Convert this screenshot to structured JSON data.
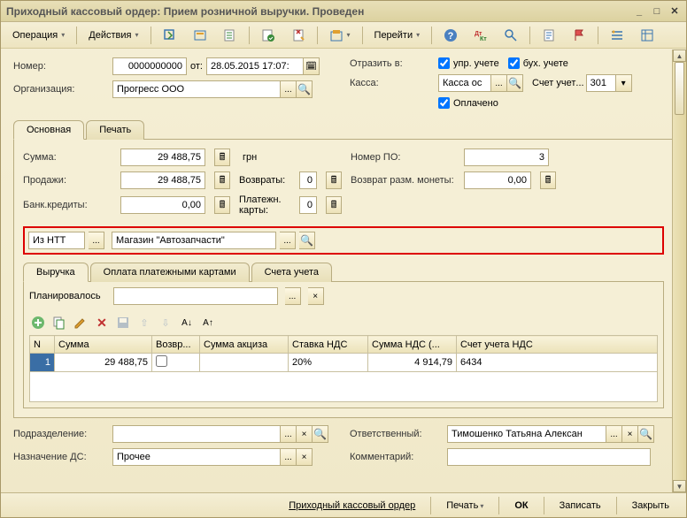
{
  "title": "Приходный кассовый ордер: Прием розничной выручки. Проведен",
  "menu": {
    "operation": "Операция",
    "actions": "Действия",
    "goto": "Перейти"
  },
  "header": {
    "number_lbl": "Номер:",
    "number": "0000000000",
    "from_lbl": "от:",
    "date": "28.05.2015 17:07:",
    "org_lbl": "Организация:",
    "org": "Прогресс ООО",
    "reflect_lbl": "Отразить в:",
    "upr": "упр. учете",
    "buh": "бух. учете",
    "kassa_lbl": "Касса:",
    "kassa": "Касса ос",
    "account_lbl": "Счет учет",
    "account": "301",
    "paid": "Оплачено"
  },
  "tabs": {
    "main": "Основная",
    "print": "Печать"
  },
  "main": {
    "sum_lbl": "Сумма:",
    "sum": "29 488,75",
    "currency": "грн",
    "sales_lbl": "Продажи:",
    "sales": "29 488,75",
    "returns_lbl": "Возвраты:",
    "returns": "0",
    "bank_lbl": "Банк.кредиты:",
    "bank": "0,00",
    "cards_lbl": "Платежн. карты:",
    "cards": "0",
    "from_ntt_lbl": "Из НТТ",
    "store": "Магазин \"Автозапчасти\"",
    "po_lbl": "Номер ПО:",
    "po": "3",
    "coin_lbl": "Возврат разм. монеты:",
    "coin": "0,00"
  },
  "subtabs": {
    "revenue": "Выручка",
    "cards": "Оплата платежными картами",
    "accounts": "Счета учета"
  },
  "plan_lbl": "Планировалось",
  "table": {
    "cols": {
      "n": "N",
      "sum": "Сумма",
      "ret": "Возвр...",
      "excise": "Сумма акциза",
      "vat_rate": "Ставка НДС",
      "vat_sum": "Сумма НДС (...",
      "vat_acc": "Счет учета НДС"
    },
    "rows": [
      {
        "n": "1",
        "sum": "29 488,75",
        "ret": false,
        "excise": "",
        "vat_rate": "20%",
        "vat_sum": "4 914,79",
        "vat_acc": "6434"
      }
    ]
  },
  "bottom": {
    "dept_lbl": "Подразделение:",
    "dept": "",
    "purpose_lbl": "Назначение ДС:",
    "purpose": "Прочее",
    "resp_lbl": "Ответственный:",
    "resp": "Тимошенко Татьяна Алексан",
    "comment_lbl": "Комментарий:",
    "comment": ""
  },
  "footer": {
    "title": "Приходный кассовый ордер",
    "print": "Печать",
    "ok": "ОК",
    "save": "Записать",
    "close": "Закрыть"
  }
}
